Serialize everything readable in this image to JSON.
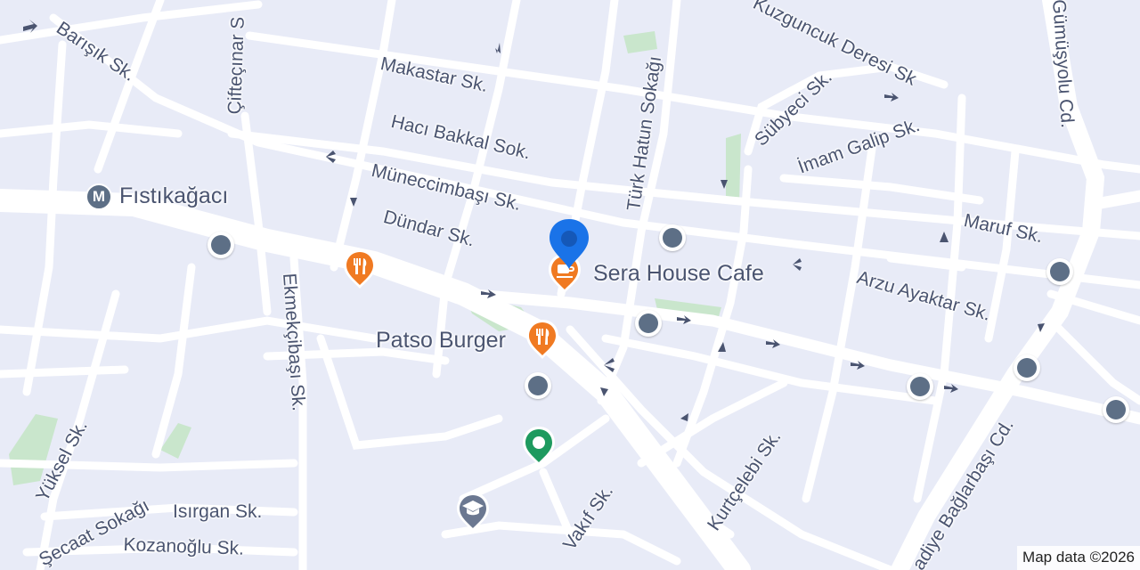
{
  "streets": {
    "barisik": "Barışık Sk.",
    "cifteciler": "Çifteçınar S",
    "makastar": "Makastar Sk.",
    "haci_bakkal": "Hacı Bakkal Sok.",
    "muneccimbasi": "Müneccimbaşı Sk.",
    "dundar": "Dündar Sk.",
    "turk_hatun": "Türk Hatun Sokağı",
    "kuzguncuk": "Kuzguncuk Deresi Sk",
    "subyeci": "Sübyeci Sk.",
    "imam_galip": "İmam Galip Sk.",
    "gumusyolu": "Gümüşyolu Cd.",
    "maruf": "Maruf Sk.",
    "arzu_ayaktar": "Arzu Ayaktar Sk.",
    "ekmekcibasi": "Ekmekçibaşı Sk.",
    "yuksel": "Yüksel Sk.",
    "secaat": "Şecaat Sokağı",
    "isirgan": "Isırgan Sk.",
    "kozanoglu": "Kozanoğlu Sk.",
    "vakif": "Vakıf Sk.",
    "kurtcelebi": "Kurtçelebi Sk.",
    "baglarbasi": "adiye Bağlarbaşı Cd."
  },
  "places": {
    "metro_station": "Fıstıkağacı",
    "metro_symbol": "M",
    "sera_house": "Sera House Cafe",
    "patso_burger": "Patso Burger"
  },
  "colors": {
    "background": "#e8ebf7",
    "road": "#ffffff",
    "park": "#c9e6cc",
    "restaurant_pin": "#f07a22",
    "location_pin": "#1a73e8",
    "green_pin": "#1e9a5f",
    "school_pin": "#6b7891",
    "transit": "#5d6f86"
  },
  "icons": [
    "location-pin-icon",
    "restaurant-icon",
    "bus-stop-icon",
    "metro-icon",
    "school-icon",
    "place-icon",
    "one-way-arrow-icon"
  ],
  "attribution": "Map data ©2026"
}
